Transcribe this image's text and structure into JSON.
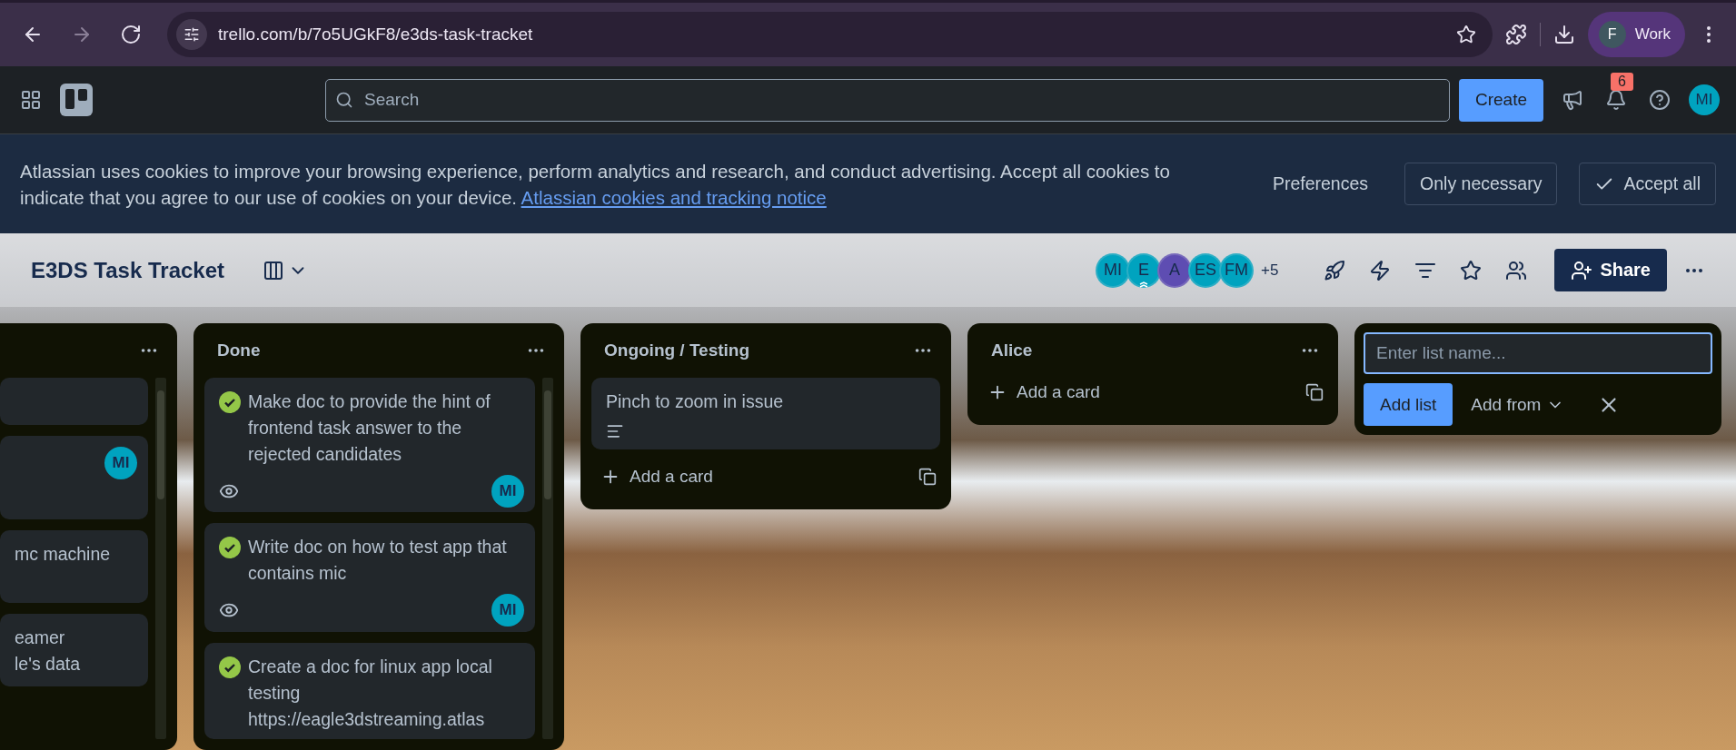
{
  "browser": {
    "nav": [
      {
        "kind": "back",
        "disabled": false
      },
      {
        "kind": "forward",
        "disabled": true
      },
      {
        "kind": "reload",
        "disabled": false
      }
    ],
    "url": "trello.com/b/7o5UGkF8/e3ds-task-tracket",
    "profile": {
      "initial": "F",
      "name": "Work"
    }
  },
  "header": {
    "search_placeholder": "Search",
    "create": "Create",
    "notifications": "6",
    "avatar": "MI"
  },
  "cookie_banner": {
    "text": "Atlassian uses cookies to improve your browsing experience, perform analytics and research, and conduct advertising. Accept all cookies to indicate that you agree to our use of cookies on your device.",
    "link": "Atlassian cookies and tracking notice",
    "buttons": [
      {
        "kind": "text",
        "label": "Preferences"
      },
      {
        "kind": "outline",
        "label": "Only necessary"
      },
      {
        "kind": "accept",
        "label": "Accept all"
      }
    ]
  },
  "board": {
    "title": "E3DS Task Tracket",
    "members": [
      {
        "initials": "MI",
        "color": "#00a3bf"
      },
      {
        "initials": "E",
        "color": "#00a3bf",
        "admin": true
      },
      {
        "initials": "A",
        "color": "#5e4db2"
      },
      {
        "initials": "ES",
        "color": "#00a3bf"
      },
      {
        "initials": "FM",
        "color": "#00a3bf"
      }
    ],
    "more_members": "+5",
    "share": "Share"
  },
  "lists": [
    {
      "kind": "partial",
      "cards": [
        {
          "kind": "blank"
        },
        {
          "kind": "blank",
          "members": [
            "MI"
          ]
        },
        {
          "kind": "text",
          "title": "mc machine"
        },
        {
          "kind": "text",
          "title": "eamer\nle's data"
        }
      ]
    },
    {
      "kind": "full",
      "title": "Done",
      "cards": [
        {
          "title": "Make doc to provide the hint of frontend task answer to the rejected candidates",
          "done": true,
          "watching": true,
          "members": [
            "MI"
          ]
        },
        {
          "title": "Write doc on how to test app that contains mic",
          "done": true,
          "watching": true,
          "members": [
            "MI"
          ]
        },
        {
          "title": "Create a doc for linux app local testing https://eagle3dstreaming.atlas",
          "done": true
        }
      ]
    },
    {
      "kind": "full",
      "title": "Ongoing / Testing",
      "cards": [
        {
          "title": "Pinch to zoom in issue",
          "description": true
        }
      ],
      "add_card": "Add a card"
    },
    {
      "kind": "full",
      "title": "Alice",
      "add_card": "Add a card"
    }
  ],
  "add_list": {
    "placeholder": "Enter list name...",
    "submit": "Add list",
    "add_from": "Add from"
  }
}
